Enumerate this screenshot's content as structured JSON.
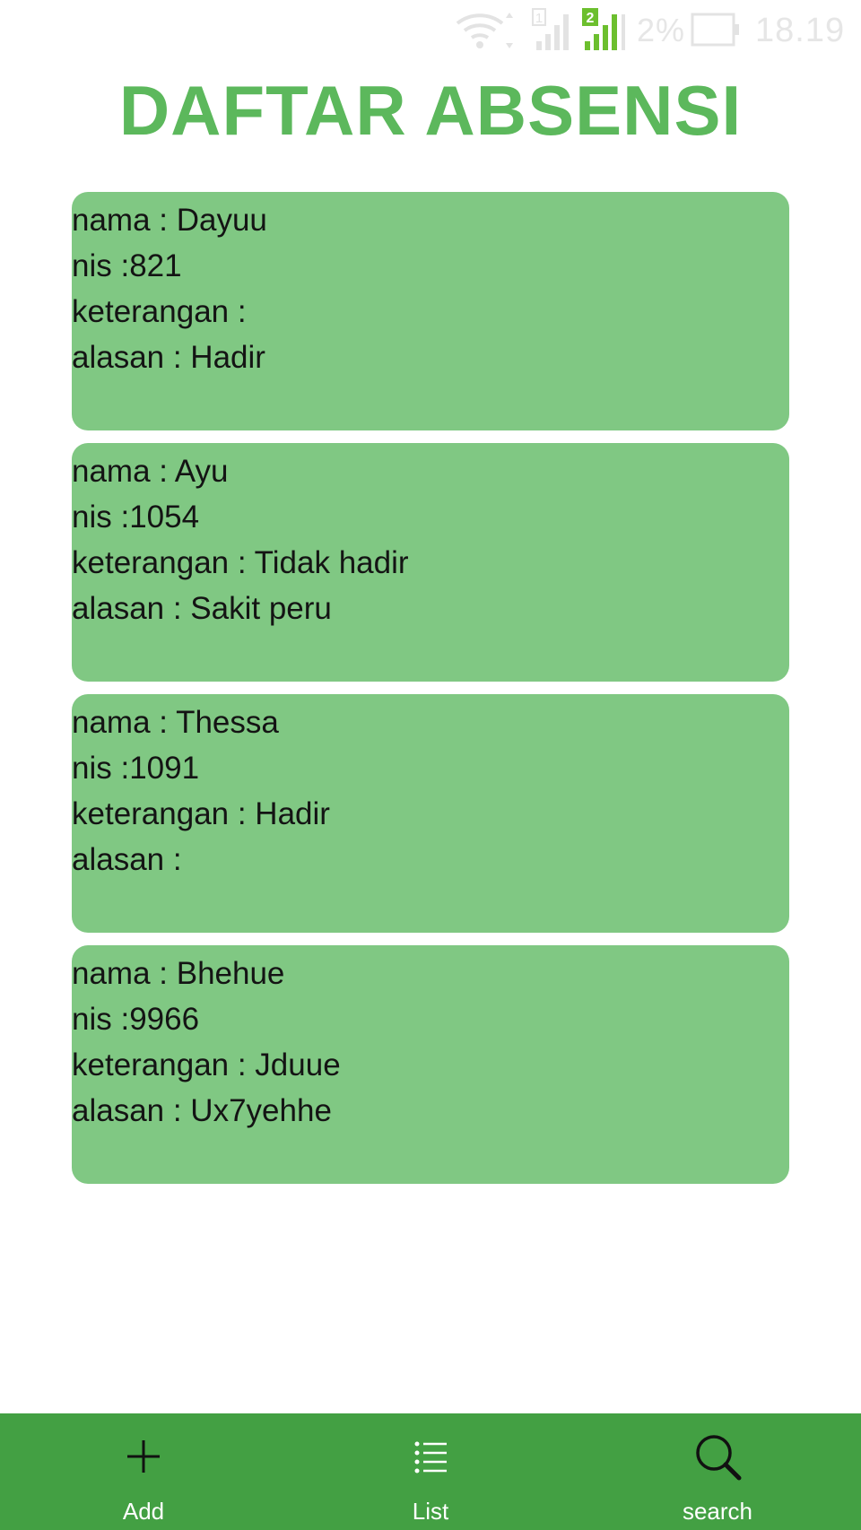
{
  "status_bar": {
    "battery_percent": "2%",
    "time": "18.19",
    "sim1_label": "1",
    "sim2_label": "2"
  },
  "title": "DAFTAR ABSENSI",
  "records": [
    {
      "nama": "nama : Dayuu",
      "nis": "nis :821",
      "keterangan": "keterangan :",
      "alasan": "alasan : Hadir"
    },
    {
      "nama": "nama : Ayu",
      "nis": "nis :1054",
      "keterangan": "keterangan : Tidak hadir",
      "alasan": "alasan : Sakit peru"
    },
    {
      "nama": "nama : Thessa",
      "nis": "nis :1091",
      "keterangan": "keterangan : Hadir",
      "alasan": "alasan :"
    },
    {
      "nama": "nama : Bhehue",
      "nis": "nis :9966",
      "keterangan": "keterangan : Jduue",
      "alasan": "alasan : Ux7yehhe"
    }
  ],
  "bottom_nav": {
    "items": [
      {
        "label": "Add",
        "icon": "plus-icon"
      },
      {
        "label": "List",
        "icon": "list-icon"
      },
      {
        "label": "search",
        "icon": "search-icon"
      }
    ]
  },
  "colors": {
    "title": "#5cb85c",
    "card_background": "#80c883",
    "nav_background": "#43a043"
  }
}
